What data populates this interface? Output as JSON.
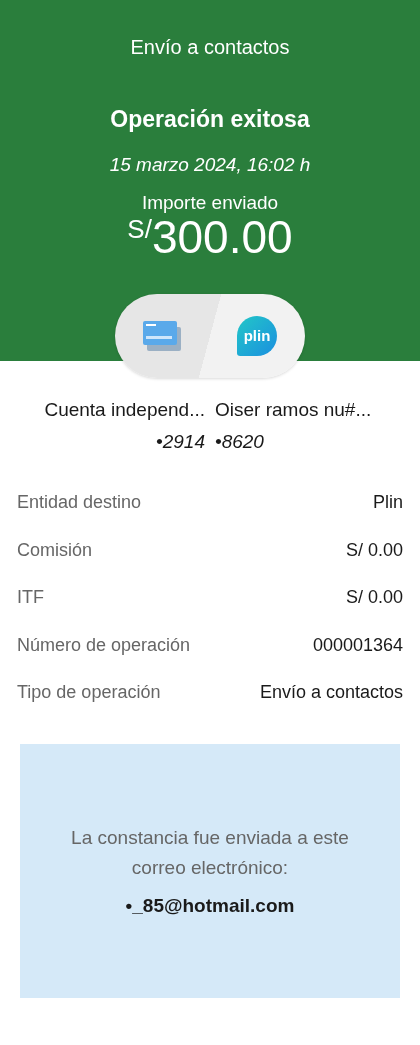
{
  "header": {
    "title": "Envío a contactos",
    "status": "Operación exitosa",
    "datetime": "15 marzo 2024,  16:02 h",
    "amount_label": "Importe enviado",
    "currency": "S/",
    "amount": "300.00"
  },
  "transfer": {
    "destination_logo": "plin",
    "from": {
      "name": "Cuenta independ...",
      "account": "•2914"
    },
    "to": {
      "name": "Oiser ramos nu#...",
      "account": "•8620"
    }
  },
  "details": [
    {
      "label": "Entidad destino",
      "value": "Plin"
    },
    {
      "label": "Comisión",
      "value": "S/ 0.00"
    },
    {
      "label": "ITF",
      "value": "S/ 0.00"
    },
    {
      "label": "Número de operación",
      "value": "000001364"
    },
    {
      "label": "Tipo de operación",
      "value": "Envío a contactos"
    }
  ],
  "notice": {
    "text": "La constancia fue enviada a este correo electrónico:",
    "email": "•_85@hotmail.com"
  }
}
